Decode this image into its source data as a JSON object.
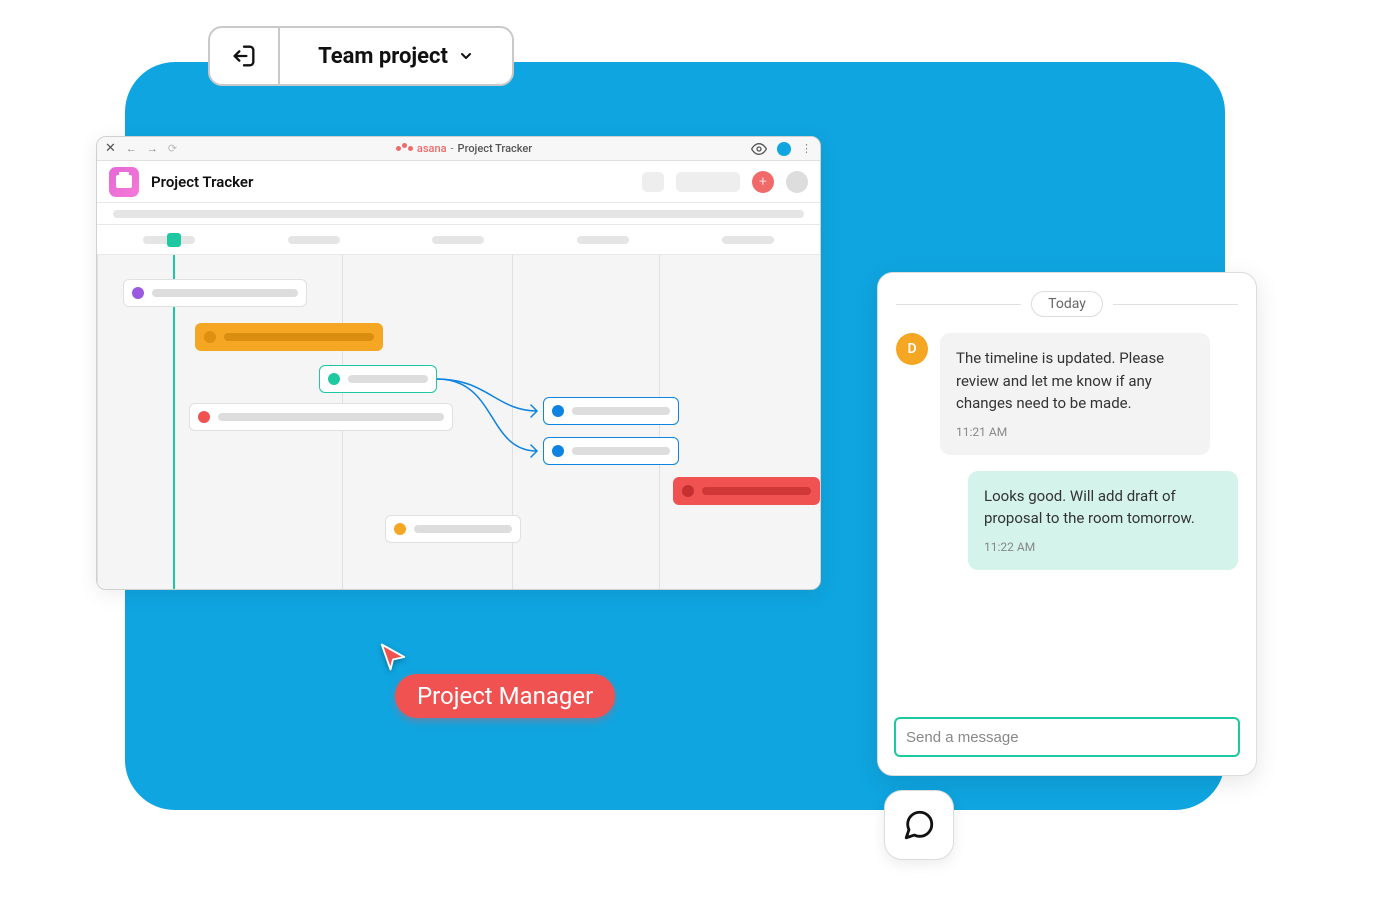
{
  "dropdown": {
    "label": "Team project"
  },
  "browser": {
    "app_brand": "asana",
    "tab_title": "Project Tracker",
    "add_label": "+"
  },
  "project": {
    "title": "Project Tracker"
  },
  "cursor": {
    "role_label": "Project Manager"
  },
  "chat": {
    "day_label": "Today",
    "messages": [
      {
        "avatar_initial": "D",
        "text": "The timeline is updated. Please review and let me know if any changes need to be made.",
        "time": "11:21 AM",
        "side": "other"
      },
      {
        "text": "Looks good. Will add draft of proposal to the room tomorrow.",
        "time": "11:22 AM",
        "side": "mine"
      }
    ],
    "input_placeholder": "Send a message"
  }
}
